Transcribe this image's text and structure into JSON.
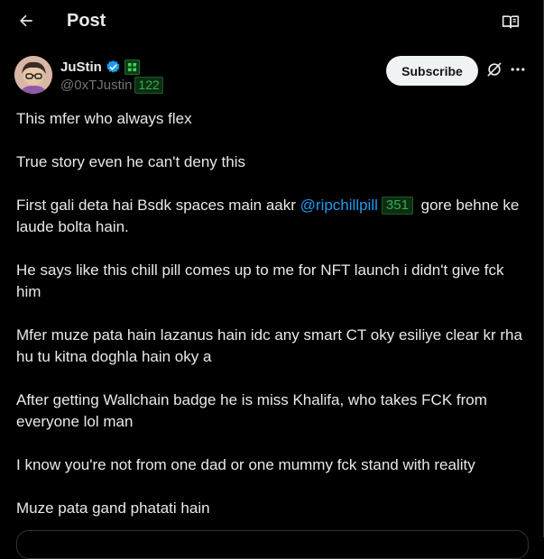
{
  "header": {
    "title": "Post",
    "back_icon": "arrow-left-icon",
    "reader_icon": "open-book-icon"
  },
  "author": {
    "display_name": "JuStin",
    "handle": "@0xTJustin",
    "score": "122",
    "verified_icon": "verified-badge-icon",
    "affiliation_icon": "affiliate-badge-icon"
  },
  "actions": {
    "subscribe_label": "Subscribe",
    "grok_icon": "grok-icon",
    "more_icon": "more-horizontal-icon"
  },
  "tweet": {
    "p1": "This mfer who always flex",
    "p2": "True story even he can't deny this",
    "p3_before": "First gali deta hai  Bsdk spaces main aakr ",
    "p3_mention": "@ripchillpill",
    "p3_score": "351",
    "p3_after": " gore behne ke laude bolta hain.",
    "p4": "He says like this chill pill comes up to me for NFT launch i didn't give fck him",
    "p5": "Mfer muze pata hain lazanus hain idc any smart CT oky esiliye clear kr rha hu tu kitna doghla hain oky a",
    "p6": "After getting Wallchain badge he is miss Khalifa, who takes FCK from everyone lol man",
    "p7": "I know you're not from one dad or one mummy fck stand with reality",
    "p8": "Muze pata gand phatati hain"
  },
  "colors": {
    "background": "#000000",
    "text": "#e7e9ea",
    "muted": "#71767b",
    "link": "#1d9bf0",
    "verified": "#1d9bf0",
    "score_green": "#2fb04a"
  }
}
